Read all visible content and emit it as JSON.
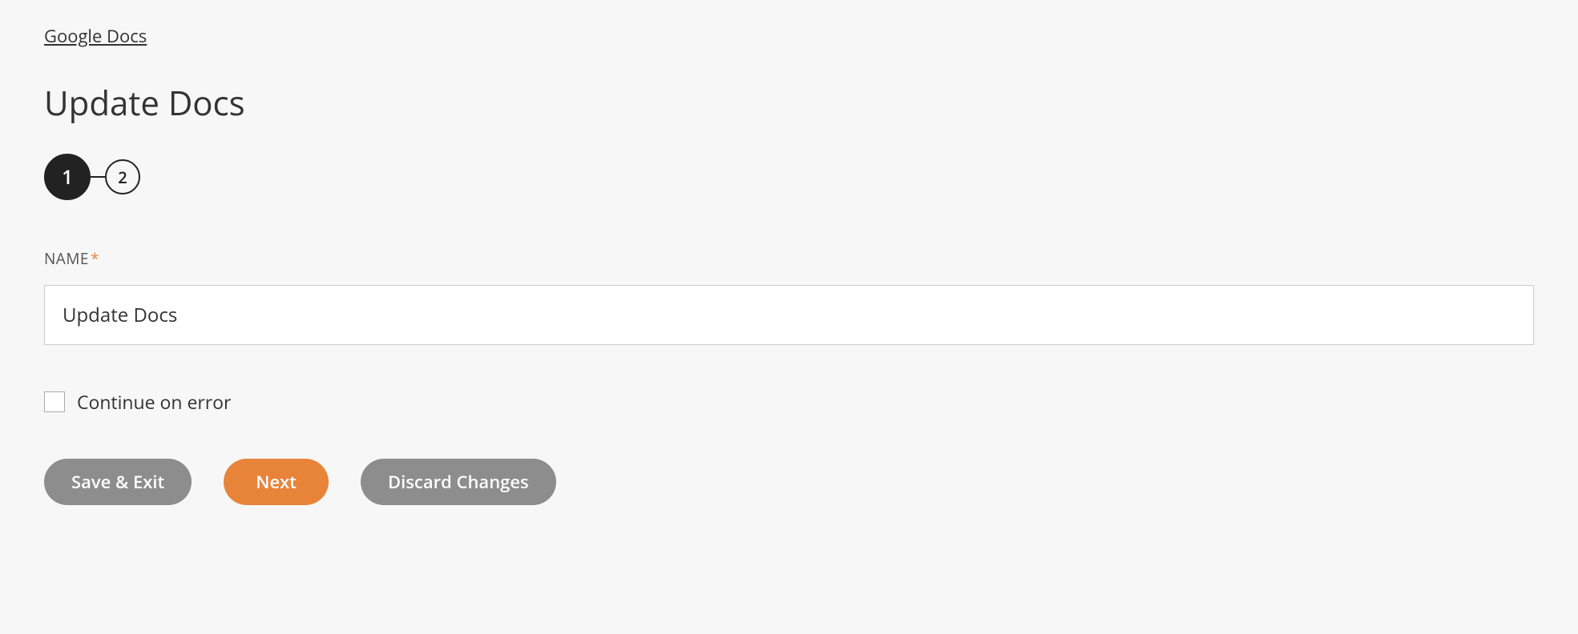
{
  "breadcrumb": {
    "label": "Google Docs"
  },
  "page": {
    "title": "Update Docs"
  },
  "stepper": {
    "steps": [
      "1",
      "2"
    ],
    "active_index": 0
  },
  "form": {
    "name_label": "NAME",
    "required_marker": "*",
    "name_value": "Update Docs",
    "continue_on_error_label": "Continue on error",
    "continue_on_error_checked": false
  },
  "buttons": {
    "save_exit": "Save & Exit",
    "next": "Next",
    "discard": "Discard Changes"
  }
}
